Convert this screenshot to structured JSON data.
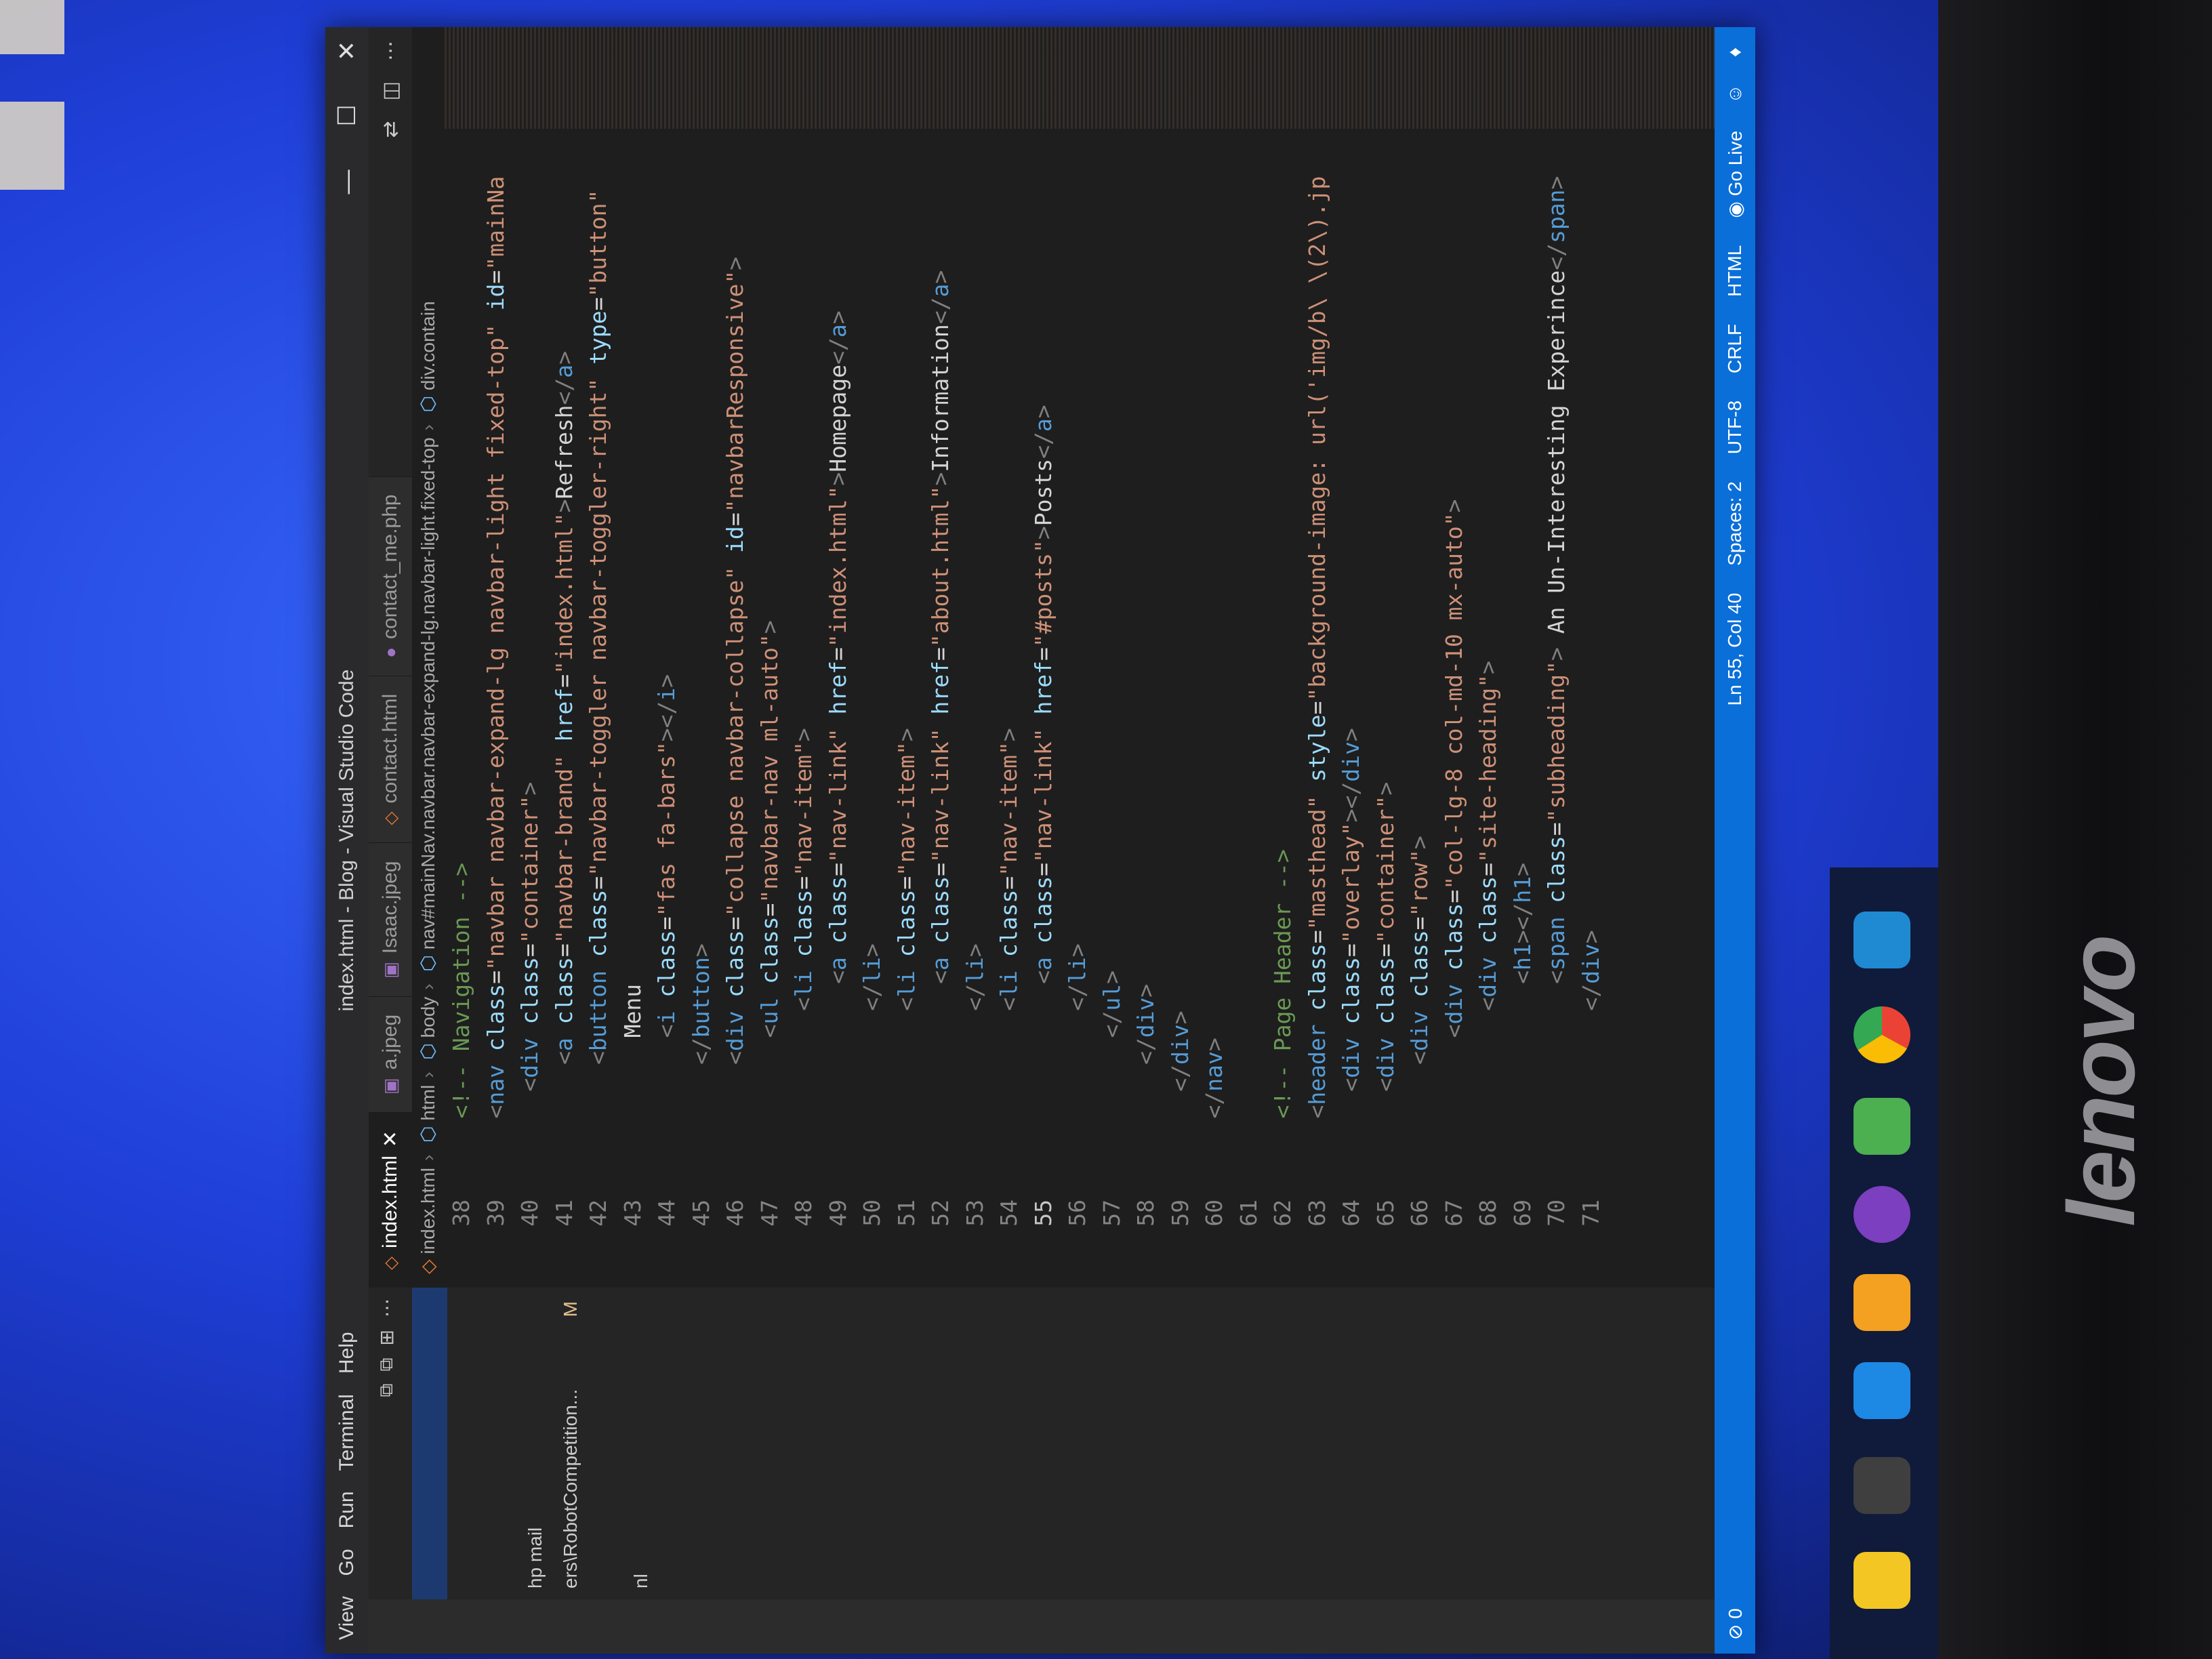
{
  "window": {
    "title": "index.html - Blog - Visual Studio Code",
    "menu": [
      "View",
      "Go",
      "Run",
      "Terminal",
      "Help"
    ]
  },
  "sidebar": {
    "items": [
      {
        "label": "",
        "selected": true
      },
      {
        "label": "",
        "selected": false
      },
      {
        "label": "",
        "selected": false
      },
      {
        "label": "hp  mail",
        "selected": false
      },
      {
        "label": "ers\\RobotCompetition...",
        "selected": false,
        "badge": "M"
      },
      {
        "label": "",
        "selected": false
      },
      {
        "label": "nl",
        "selected": false
      },
      {
        "label": "",
        "selected": false
      }
    ]
  },
  "tabs": [
    {
      "label": "index.html",
      "active": true,
      "icon": "html-icon"
    },
    {
      "label": "a.jpeg",
      "active": false,
      "icon": "image-icon"
    },
    {
      "label": "Isaac.jpeg",
      "active": false,
      "icon": "image-icon"
    },
    {
      "label": "contact.html",
      "active": false,
      "icon": "html-icon"
    },
    {
      "label": "contact_me.php",
      "active": false,
      "icon": "php-icon"
    }
  ],
  "breadcrumb": [
    "index.html",
    "html",
    "body",
    "nav#mainNav.navbar.navbar-expand-lg.navbar-light.fixed-top",
    "div.contain"
  ],
  "code": {
    "current_line": 55,
    "lines": [
      {
        "n": "38",
        "t": "    <!-- Navigation -->"
      },
      {
        "n": "39",
        "t": "    <nav class=\"navbar navbar-expand-lg navbar-light fixed-top\" id=\"mainNa"
      },
      {
        "n": "40",
        "t": "      <div class=\"container\">"
      },
      {
        "n": "41",
        "t": "        <a class=\"navbar-brand\" href=\"index.html\">Refresh</a>"
      },
      {
        "n": "42",
        "t": "        <button class=\"navbar-toggler navbar-toggler-right\" type=\"button\" "
      },
      {
        "n": "43",
        "t": "          Menu"
      },
      {
        "n": "44",
        "t": "          <i class=\"fas fa-bars\"></i>"
      },
      {
        "n": "45",
        "t": "        </button>"
      },
      {
        "n": "46",
        "t": "        <div class=\"collapse navbar-collapse\" id=\"navbarResponsive\">"
      },
      {
        "n": "47",
        "t": "          <ul class=\"navbar-nav ml-auto\">"
      },
      {
        "n": "48",
        "t": "            <li class=\"nav-item\">"
      },
      {
        "n": "49",
        "t": "              <a class=\"nav-link\" href=\"index.html\">Homepage</a>"
      },
      {
        "n": "50",
        "t": "            </li>"
      },
      {
        "n": "51",
        "t": "            <li class=\"nav-item\">"
      },
      {
        "n": "52",
        "t": "              <a class=\"nav-link\" href=\"about.html\">Information</a>"
      },
      {
        "n": "53",
        "t": "            </li>"
      },
      {
        "n": "54",
        "t": "            <li class=\"nav-item\">"
      },
      {
        "n": "55",
        "t": "              <a class=\"nav-link\" href=\"#posts\">Posts</a>"
      },
      {
        "n": "56",
        "t": "            </li>"
      },
      {
        "n": "57",
        "t": "          </ul>"
      },
      {
        "n": "58",
        "t": "        </div>"
      },
      {
        "n": "59",
        "t": "      </div>"
      },
      {
        "n": "60",
        "t": "    </nav>"
      },
      {
        "n": "61",
        "t": ""
      },
      {
        "n": "62",
        "t": "    <!-- Page Header -->"
      },
      {
        "n": "63",
        "t": "    <header class=\"masthead\" style=\"background-image: url('img/b\\ \\(2\\).jp"
      },
      {
        "n": "64",
        "t": "      <div class=\"overlay\"></div>"
      },
      {
        "n": "65",
        "t": "      <div class=\"container\">"
      },
      {
        "n": "66",
        "t": "        <div class=\"row\">"
      },
      {
        "n": "67",
        "t": "          <div class=\"col-lg-8 col-md-10 mx-auto\">"
      },
      {
        "n": "68",
        "t": "            <div class=\"site-heading\">"
      },
      {
        "n": "69",
        "t": "              <h1></h1>"
      },
      {
        "n": "70",
        "t": "              <span class=\"subheading\"> An Un-Interesting Experince</span>"
      },
      {
        "n": "71",
        "t": "            </div>"
      }
    ]
  },
  "statusbar": {
    "left": "⊘ 0",
    "position": "Ln 55, Col 40",
    "spaces": "Spaces: 2",
    "encoding": "UTF-8",
    "eol": "CRLF",
    "language": "HTML",
    "golive": "Go Live"
  },
  "brand": "lenovo",
  "colors": {
    "editor_bg": "#1e1e1e",
    "statusbar": "#0a6fd8",
    "tag": "#569cd6",
    "attr": "#9cdcfe",
    "string": "#ce9178",
    "comment": "#6a9955"
  }
}
